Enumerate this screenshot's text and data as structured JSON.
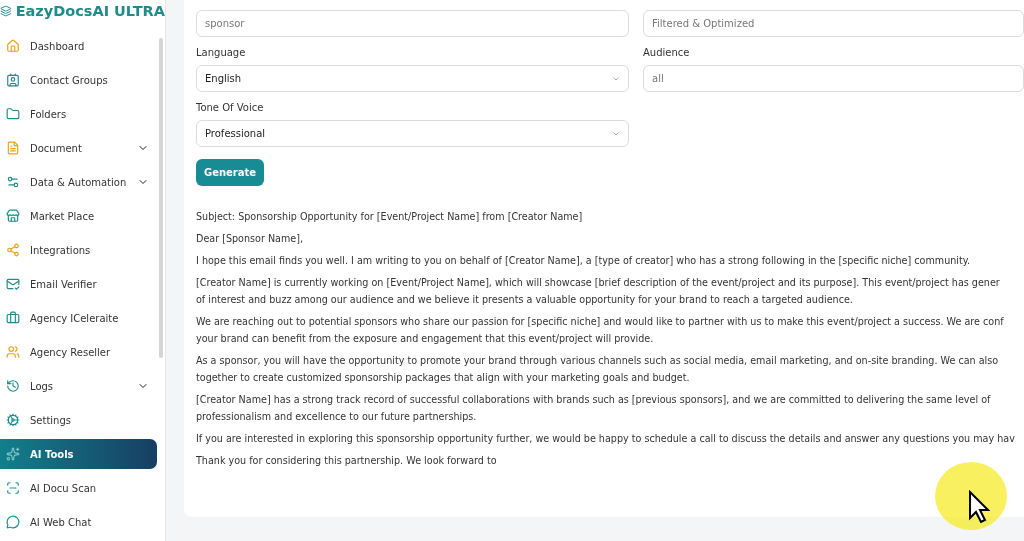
{
  "sidebar": {
    "logo": "EazyDocsAI ULTRA",
    "items": [
      {
        "label": "Dashboard",
        "selected": false,
        "has_submenu": false
      },
      {
        "label": "Contact Groups",
        "selected": false,
        "has_submenu": false
      },
      {
        "label": "Folders",
        "selected": false,
        "has_submenu": false
      },
      {
        "label": "Document",
        "selected": false,
        "has_submenu": true
      },
      {
        "label": "Data & Automation",
        "selected": false,
        "has_submenu": true
      },
      {
        "label": "Market Place",
        "selected": false,
        "has_submenu": false
      },
      {
        "label": "Integrations",
        "selected": false,
        "has_submenu": false
      },
      {
        "label": "Email Verifier",
        "selected": false,
        "has_submenu": false
      },
      {
        "label": "Agency ICeleraite",
        "selected": false,
        "has_submenu": false
      },
      {
        "label": "Agency Reseller",
        "selected": false,
        "has_submenu": false
      },
      {
        "label": "Logs",
        "selected": false,
        "has_submenu": true
      },
      {
        "label": "Settings",
        "selected": false,
        "has_submenu": false
      },
      {
        "label": "AI Tools",
        "selected": true,
        "has_submenu": false
      },
      {
        "label": "AI Docu Scan",
        "selected": false,
        "has_submenu": false
      },
      {
        "label": "AI Web Chat",
        "selected": false,
        "has_submenu": false
      }
    ]
  },
  "form": {
    "left": [
      {
        "kind": "input",
        "placeholder": "sponsor"
      },
      {
        "label": "Language",
        "kind": "select",
        "value": "English"
      },
      {
        "label": "Tone Of Voice",
        "kind": "select",
        "value": "Professional"
      }
    ],
    "right": [
      {
        "placeholder": "Filtered & Optimized"
      },
      {
        "label": "Audience",
        "placeholder": "all"
      }
    ],
    "button": "Generate"
  },
  "output": [
    [
      "Subject: Sponsorship Opportunity for [Event/Project Name] from [Creator Name]"
    ],
    [
      "Dear [Sponsor Name],"
    ],
    [
      "I hope this email finds you well. I am writing to you on behalf of [Creator Name], a [type of creator] who has a strong following in the [specific niche] community."
    ],
    [
      "[Creator Name] is currently working on [Event/Project Name], which will showcase [brief description of the event/project and its purpose]. This event/project has gener",
      "of interest and buzz among our audience and we believe it presents a valuable opportunity for your brand to reach a targeted audience."
    ],
    [
      "We are reaching out to potential sponsors who share our passion for [specific niche] and would like to partner with us to make this event/project a success. We are conf",
      "your brand can benefit from the exposure and engagement that this event/project will provide."
    ],
    [
      "As a sponsor, you will have the opportunity to promote your brand through various channels such as social media, email marketing, and on-site branding. We can also",
      "together to create customized sponsorship packages that align with your marketing goals and budget."
    ],
    [
      "[Creator Name] has a strong track record of successful collaborations with brands such as [previous sponsors], and we are committed to delivering the same level of",
      "professionalism and excellence to our future partnerships."
    ],
    [
      "If you are interested in exploring this sponsorship opportunity further, we would be happy to schedule a call to discuss the details and answer any questions you may hav"
    ],
    [
      "Thank you for considering this partnership. We look forward to"
    ]
  ]
}
